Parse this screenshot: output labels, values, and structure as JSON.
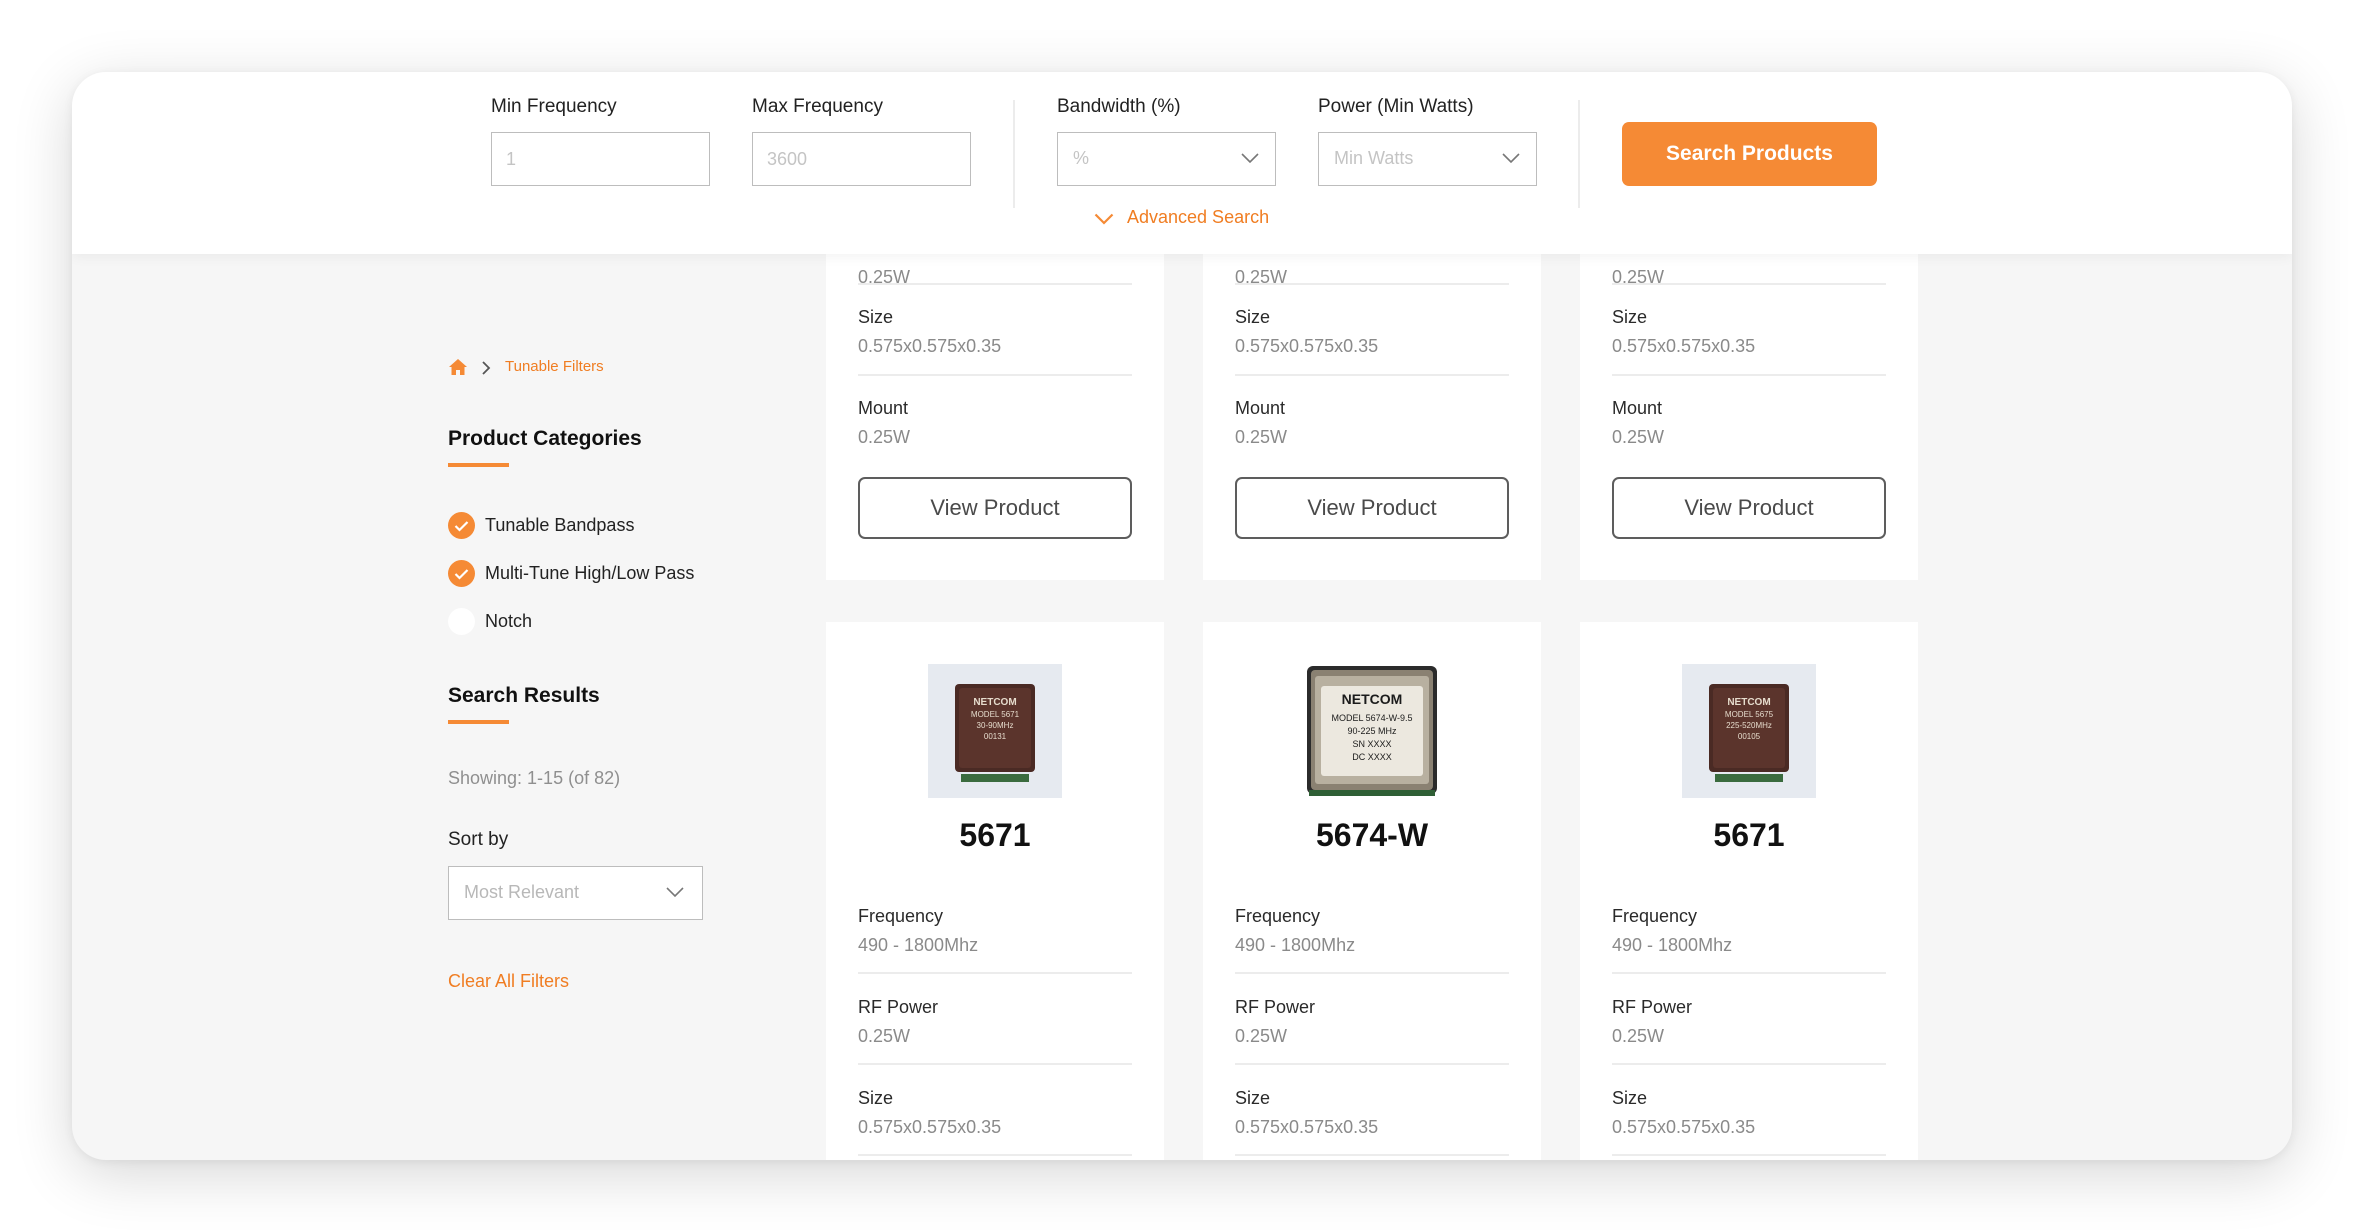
{
  "colors": {
    "accent": "#f58a35",
    "link": "#f07d22",
    "panel_bg": "#f6f6f6",
    "card_bg": "#ffffff"
  },
  "filters": {
    "min_frequency": {
      "label": "Min Frequency",
      "placeholder": "1"
    },
    "max_frequency": {
      "label": "Max Frequency",
      "placeholder": "3600"
    },
    "bandwidth": {
      "label": "Bandwidth (%)",
      "placeholder": "%"
    },
    "power": {
      "label": "Power (Min Watts)",
      "placeholder": "Min Watts"
    },
    "search_button": "Search Products",
    "advanced_search": "Advanced Search"
  },
  "breadcrumb": {
    "home_icon": "home-icon",
    "current": "Tunable Filters"
  },
  "sidebar": {
    "categories_title": "Product Categories",
    "categories": [
      {
        "label": "Tunable Bandpass",
        "checked": true
      },
      {
        "label": "Multi-Tune High/Low Pass",
        "checked": true
      },
      {
        "label": "Notch",
        "checked": false
      }
    ],
    "results_title": "Search Results",
    "showing": "Showing: 1-15 (of 82)",
    "sort_label": "Sort by",
    "sort_value": "Most Relevant",
    "clear_filters": "Clear All Filters"
  },
  "products_top": [
    {
      "partial_value": "0.25W",
      "size_label": "Size",
      "size": "0.575x0.575x0.35",
      "mount_label": "Mount",
      "mount": "0.25W",
      "button": "View Product"
    },
    {
      "partial_value": "0.25W",
      "size_label": "Size",
      "size": "0.575x0.575x0.35",
      "mount_label": "Mount",
      "mount": "0.25W",
      "button": "View Product"
    },
    {
      "partial_value": "0.25W",
      "size_label": "Size",
      "size": "0.575x0.575x0.35",
      "mount_label": "Mount",
      "mount": "0.25W",
      "button": "View Product"
    }
  ],
  "products_bottom": [
    {
      "model": "5671",
      "image_text": [
        "NETCOM",
        "MODEL 5671",
        "30-90MHz",
        "00131"
      ],
      "frequency_label": "Frequency",
      "frequency": "490 - 1800Mhz",
      "rf_label": "RF Power",
      "rf_power": "0.25W",
      "size_label": "Size",
      "size": "0.575x0.575x0.35"
    },
    {
      "model": "5674-W",
      "image_text": [
        "NETCOM",
        "MODEL 5674-W-9.5",
        "90-225 MHz",
        "SN XXXX",
        "DC XXXX"
      ],
      "frequency_label": "Frequency",
      "frequency": "490 - 1800Mhz",
      "rf_label": "RF Power",
      "rf_power": "0.25W",
      "size_label": "Size",
      "size": "0.575x0.575x0.35"
    },
    {
      "model": "5671",
      "image_text": [
        "NETCOM",
        "MODEL 5675",
        "225-520MHz",
        "00105"
      ],
      "frequency_label": "Frequency",
      "frequency": "490 - 1800Mhz",
      "rf_label": "RF Power",
      "rf_power": "0.25W",
      "size_label": "Size",
      "size": "0.575x0.575x0.35"
    }
  ]
}
